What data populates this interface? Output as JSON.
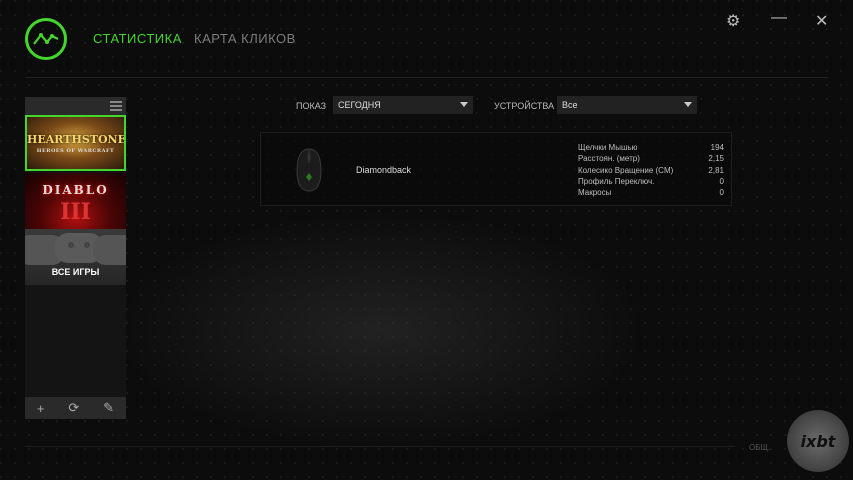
{
  "header": {
    "tabs": [
      {
        "label": "СТАТИСТИКА",
        "active": true
      },
      {
        "label": "КАРТА КЛИКОВ",
        "active": false
      }
    ],
    "window_controls": {
      "settings": "⚙",
      "minimize": "—",
      "close": "✕"
    }
  },
  "sidebar": {
    "games": [
      {
        "name": "Hearthstone",
        "logo_text": "HEARTHSTONE",
        "logo_sub": "HEROES OF WARCRAFT",
        "selected": true
      },
      {
        "name": "Diablo III",
        "logo_text": "DIABLO",
        "logo_sub": "III",
        "selected": false
      },
      {
        "name": "all-games",
        "label": "ВСЕ ИГРЫ",
        "selected": false
      }
    ],
    "footer": {
      "add": "+",
      "refresh": "⟳",
      "edit": "✎"
    }
  },
  "filters": {
    "show_label": "ПОКАЗ",
    "show_value": "СЕГОДНЯ",
    "devices_label": "УСТРОЙСТВА",
    "devices_value": "Все"
  },
  "device": {
    "name": "Diamondback",
    "stats": [
      {
        "label": "Щелчки Мышью",
        "value": "194"
      },
      {
        "label": "Расстоян. (метр)",
        "value": "2,15"
      },
      {
        "label": "Колесико Вращение (CM)",
        "value": "2,81"
      },
      {
        "label": "Профиль Переключ.",
        "value": "0"
      },
      {
        "label": "Макросы",
        "value": "0"
      }
    ]
  },
  "footer": {
    "label": "ОБЩ."
  },
  "watermark": {
    "text": "ixbt"
  },
  "colors": {
    "accent": "#44d62c",
    "background": "#0b0b0b"
  }
}
